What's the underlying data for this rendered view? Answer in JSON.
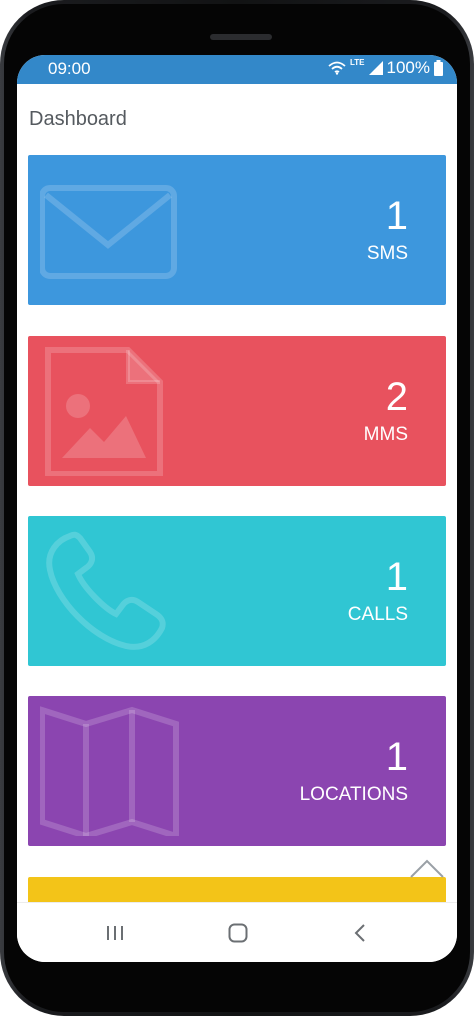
{
  "status_bar": {
    "time": "09:00",
    "network": "LTE",
    "battery": "100%"
  },
  "page": {
    "title": "Dashboard"
  },
  "cards": [
    {
      "count": "1",
      "label": "SMS",
      "icon": "envelope-icon",
      "color": "#3d97dd"
    },
    {
      "count": "2",
      "label": "MMS",
      "icon": "image-file-icon",
      "color": "#e8525e"
    },
    {
      "count": "1",
      "label": "CALLS",
      "icon": "phone-icon",
      "color": "#30c6d3"
    },
    {
      "count": "1",
      "label": "LOCATIONS",
      "icon": "map-icon",
      "color": "#8b45b0"
    }
  ],
  "colors": {
    "status_bar": "#3388c9",
    "next_card": "#f3c418"
  },
  "nav_bar": {
    "recent": "recent-apps-icon",
    "home": "home-icon",
    "back": "back-icon"
  }
}
